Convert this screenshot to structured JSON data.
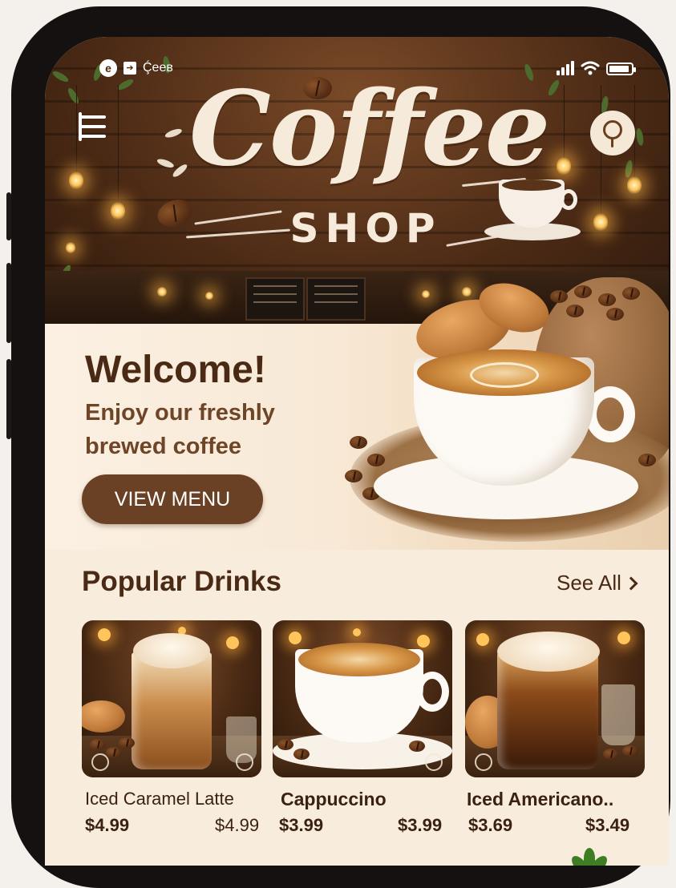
{
  "status_bar": {
    "left_text": "Ḉeeв",
    "carrier_icon": "e-logo-icon",
    "notification_icon": "arrow-box-icon",
    "signal_icon": "signal-bars-icon",
    "wifi_icon": "wifi-icon",
    "battery_icon": "battery-icon"
  },
  "header": {
    "logo_script": "Coffee",
    "logo_word": "SHOP",
    "menu_icon": "menu-list-icon",
    "search_icon": "search-icon"
  },
  "hero": {
    "title": "Welcome!",
    "subtitle": "Enjoy our freshly brewed coffee",
    "cta_label": "VIEW MENU"
  },
  "popular": {
    "title": "Popular Drinks",
    "see_all": "See All",
    "items": [
      {
        "name": "Iced Caramel Latte",
        "price": "$4.99",
        "alt_price": "$4.99"
      },
      {
        "name": "Cappuccino",
        "price": "$3.99",
        "alt_price": "$3.99"
      },
      {
        "name": "Iced Americano..",
        "price": "$3.69",
        "alt_price": "$3.49"
      }
    ]
  },
  "colors": {
    "brand_brown": "#6b4125",
    "text_dark": "#4a2a14",
    "cream": "#f8ecdd"
  }
}
